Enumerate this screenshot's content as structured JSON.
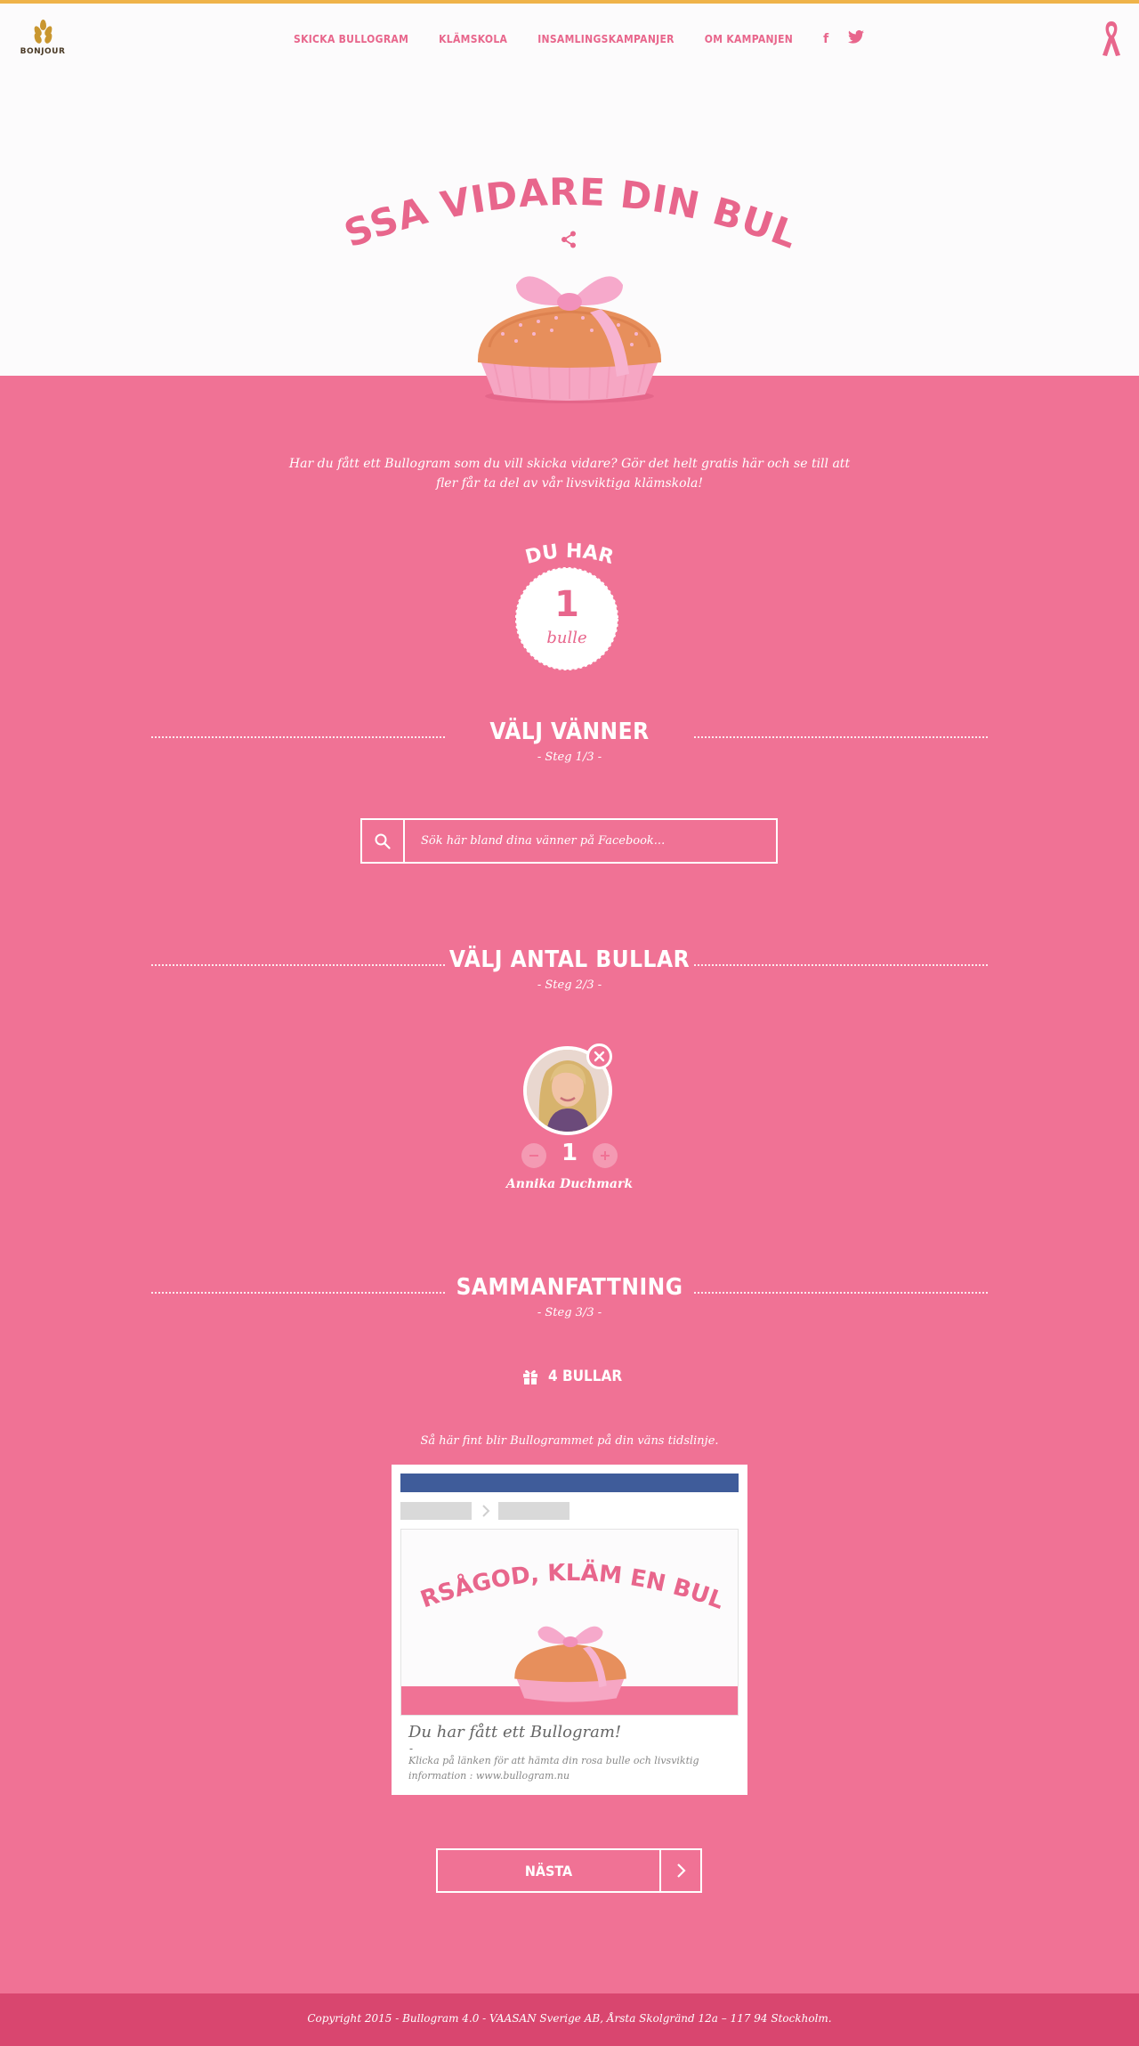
{
  "brand": {
    "logo_text": "BONJOUR",
    "accent": "#efb34a",
    "pink": "#f07295",
    "pink_dark": "#d9466f",
    "hero_title_color": "#e8668c"
  },
  "nav": {
    "items": [
      {
        "label": "SKICKA BULLOGRAM"
      },
      {
        "label": "KLÄMSKOLA"
      },
      {
        "label": "INSAMLINGSKAMPANJER"
      },
      {
        "label": "OM KAMPANJEN"
      }
    ],
    "social": [
      {
        "icon": "facebook-icon",
        "glyph": "f"
      },
      {
        "icon": "twitter-icon"
      }
    ]
  },
  "hero": {
    "title": "PASSA VIDARE DIN BULLE"
  },
  "intro": "Har du fått ett Bullogram som du vill skicka vidare? Gör det helt gratis här och se till att fler får ta del av vår livsviktiga klämskola!",
  "counter": {
    "heading": "DU HAR",
    "value": "1",
    "unit": "bulle"
  },
  "steps": [
    {
      "title": "VÄLJ VÄNNER",
      "step": "- Steg 1/3 -"
    },
    {
      "title": "VÄLJ ANTAL BULLAR",
      "step": "- Steg 2/3 -"
    },
    {
      "title": "SAMMANFATTNING",
      "step": "- Steg 3/3 -"
    }
  ],
  "search": {
    "placeholder": "Sök här bland dina vänner på Facebook..."
  },
  "friend": {
    "name": "Annika Duchmark",
    "quantity": "1"
  },
  "summary": {
    "count_label": "4 BULLAR",
    "caption": "Så här fint blir Bullogrammet på din väns tidslinje.",
    "preview": {
      "card_title": "VARSÅGOD, KLÄM EN BULLE",
      "post_title": "Du har fått ett Bullogram!",
      "dash": "-",
      "post_desc": "Klicka på länken för att hämta din rosa bulle och livsviktig information : www.bullogram.nu"
    }
  },
  "next_label": "NÄSTA",
  "footer": "Copyright 2015 - Bullogram 4.0 - VAASAN Sverige AB, Årsta Skolgränd 12a – 117 94 Stockholm."
}
